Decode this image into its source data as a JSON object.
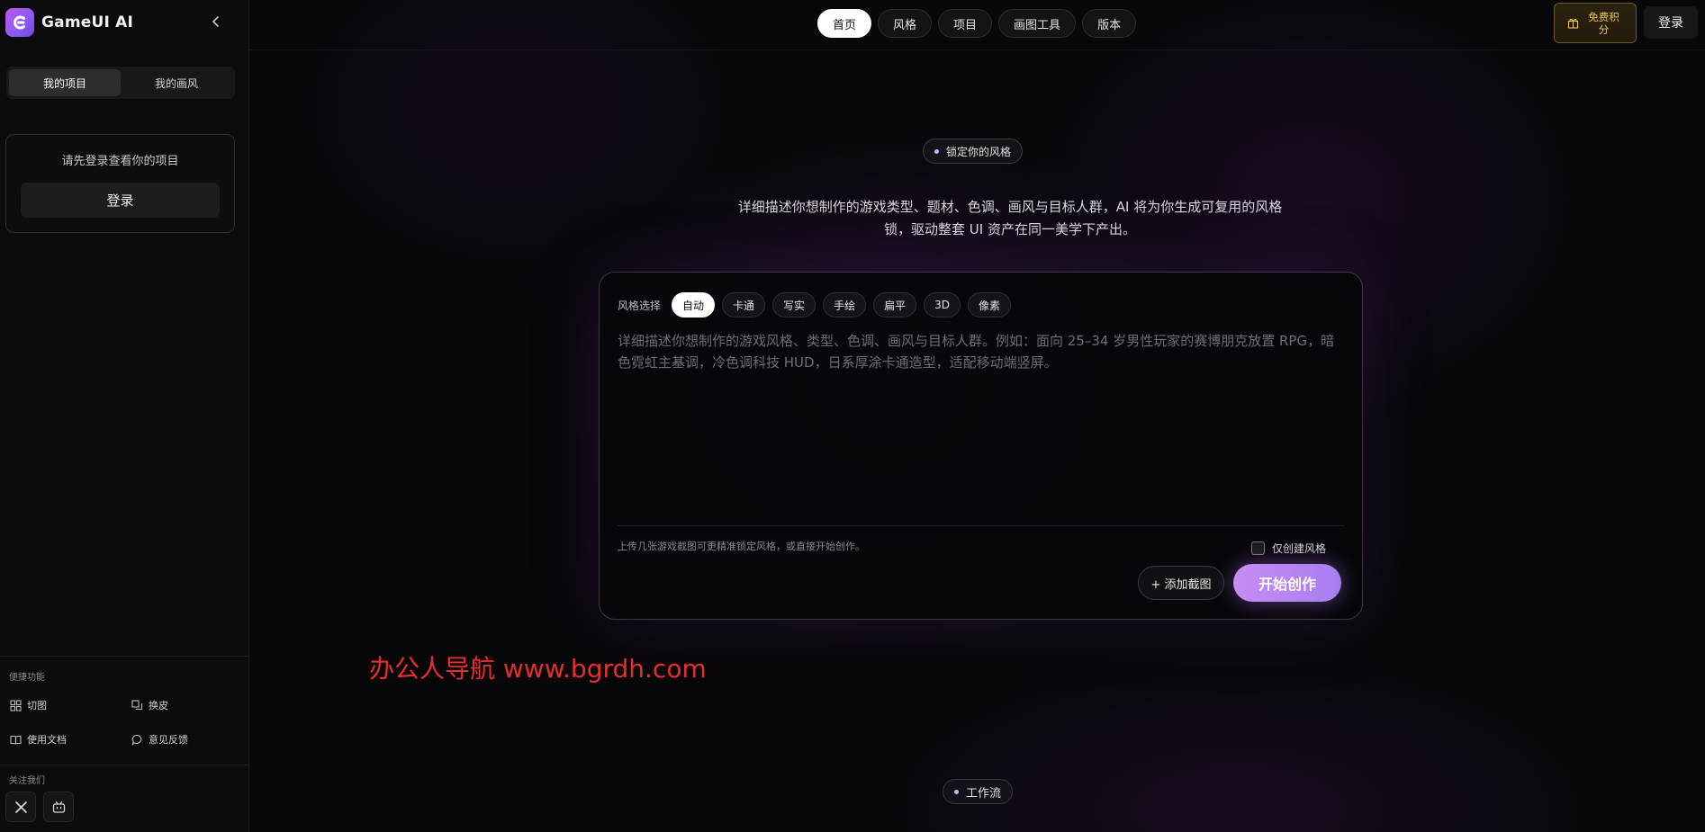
{
  "brand": {
    "name": "GameUI AI"
  },
  "sidebar": {
    "tabs": [
      {
        "label": "我的项目",
        "active": true
      },
      {
        "label": "我的画风",
        "active": false
      }
    ],
    "login_card": {
      "text": "请先登录查看你的项目",
      "button": "登录"
    },
    "quick_section": {
      "title": "便捷功能"
    },
    "quick_items": [
      {
        "label": "切图",
        "icon": "grid-icon"
      },
      {
        "label": "换皮",
        "icon": "layers-icon"
      },
      {
        "label": "使用文档",
        "icon": "book-icon"
      },
      {
        "label": "意见反馈",
        "icon": "chat-bubble-icon"
      }
    ],
    "follow_section": {
      "title": "关注我们"
    },
    "social": [
      {
        "name": "x-icon"
      },
      {
        "name": "bilibili-icon"
      }
    ]
  },
  "nav": {
    "items": [
      {
        "label": "首页",
        "active": true
      },
      {
        "label": "风格",
        "active": false
      },
      {
        "label": "项目",
        "active": false
      },
      {
        "label": "画图工具",
        "active": false
      },
      {
        "label": "版本",
        "active": false
      }
    ]
  },
  "header": {
    "points_label": "免费积分",
    "login_label": "登录"
  },
  "hero": {
    "badge": "锁定你的风格",
    "description_line1": "详细描述你想制作的游戏类型、题材、色调、画风与目标人群，AI 将为你生成可复用的风格",
    "description_line2": "锁，驱动整套 UI 资产在同一美学下产出。"
  },
  "composer": {
    "style_label": "风格选择",
    "styles": [
      {
        "label": "自动",
        "active": true
      },
      {
        "label": "卡通",
        "active": false
      },
      {
        "label": "写实",
        "active": false
      },
      {
        "label": "手绘",
        "active": false
      },
      {
        "label": "扁平",
        "active": false
      },
      {
        "label": "3D",
        "active": false
      },
      {
        "label": "像素",
        "active": false
      }
    ],
    "prompt_value": "",
    "prompt_placeholder": "详细描述你想制作的游戏风格、类型、色调、画风与目标人群。例如：面向 25–34 岁男性玩家的赛博朋克放置 RPG，暗色霓虹主基调，冷色调科技 HUD，日系厚涂卡通造型，适配移动端竖屏。",
    "hint": "上传几张游戏截图可更精准锁定风格，或直接开始创作。",
    "only_style_label": "仅创建风格",
    "only_style_checked": false,
    "add_screenshot_label": "+ 添加截图",
    "start_label": "开始创作"
  },
  "workflow_badge": "工作流",
  "watermark": "办公人导航 www.bgrdh.com",
  "colors": {
    "accent_start": "#c98cf5",
    "accent_end": "#a67ef2",
    "points_text": "#f0c35a",
    "watermark": "#e3302d"
  }
}
